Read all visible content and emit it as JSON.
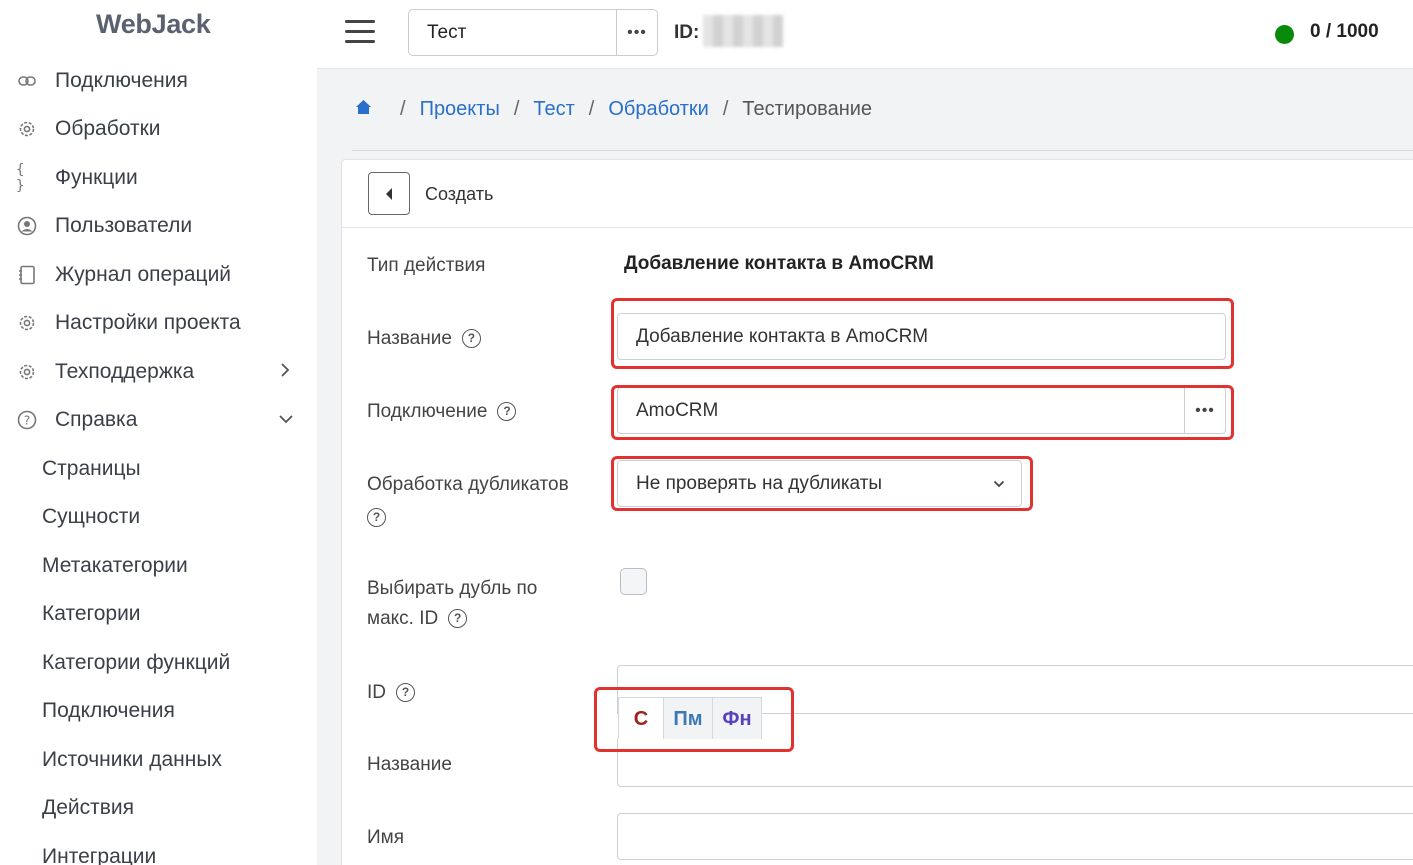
{
  "sidebar": {
    "logo": "WebJack",
    "items": [
      {
        "label": "Подключения",
        "icon": "link-icon"
      },
      {
        "label": "Обработки",
        "icon": "gear-icon"
      },
      {
        "label": "Функции",
        "icon": "braces-icon"
      },
      {
        "label": "Пользователи",
        "icon": "user-icon"
      },
      {
        "label": "Журнал операций",
        "icon": "journal-icon"
      },
      {
        "label": "Настройки проекта",
        "icon": "gear-icon"
      },
      {
        "label": "Техподдержка",
        "icon": "gear-icon"
      },
      {
        "label": "Справка",
        "icon": "help-icon"
      }
    ],
    "subitems": [
      "Страницы",
      "Сущности",
      "Метакатегории",
      "Категории",
      "Категории функций",
      "Подключения",
      "Источники данных",
      "Действия",
      "Интеграции"
    ]
  },
  "topbar": {
    "project": "Тест",
    "id_label": "ID:",
    "quota": "0 / 1000"
  },
  "breadcrumb": {
    "items": [
      "Проекты",
      "Тест",
      "Обработки"
    ],
    "current": "Тестирование"
  },
  "card": {
    "title": "Создать"
  },
  "form": {
    "action_type_label": "Тип действия",
    "action_type_value": "Добавление контакта в AmoCRM",
    "name_label": "Название",
    "name_value": "Добавление контакта в AmoCRM",
    "connection_label": "Подключение",
    "connection_value": "AmoCRM",
    "duplicates_label": "Обработка дубликатов",
    "duplicates_value": "Не проверять на дубликаты",
    "max_id_label_line1": "Выбирать дубль по",
    "max_id_label_line2": "макс. ID",
    "max_id_checked": false,
    "id_label": "ID",
    "name2_label": "Название",
    "first_name_label": "Имя"
  },
  "toolbar": {
    "btn_c": "С",
    "btn_pm": "Пм",
    "btn_fn": "Фн"
  },
  "colors": {
    "link": "#2a6fc9",
    "highlight": "#e0332f",
    "status_online": "#0a8a0a",
    "btn_c": "#a0201c",
    "btn_pm": "#3c78b4",
    "btn_fn": "#5a3fc0"
  }
}
